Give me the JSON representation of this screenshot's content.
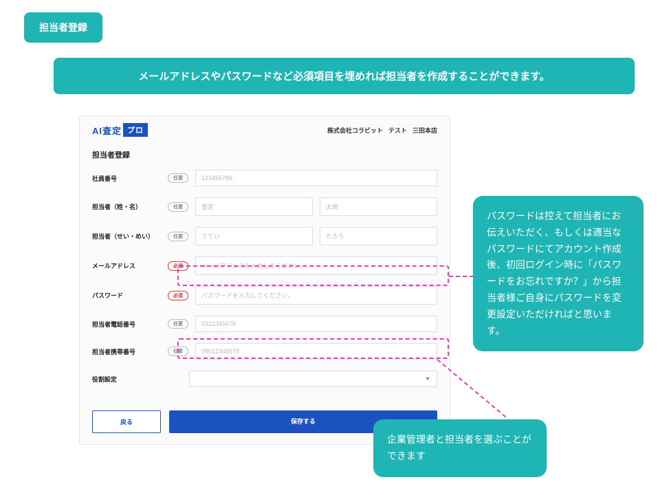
{
  "section_badge": "担当者登録",
  "instruction_banner": "メールアドレスやパスワードなど必須項目を埋めれば担当者を作成することができます。",
  "logo": {
    "text": "AI査定",
    "box": "プロ"
  },
  "company": {
    "name": "株式会社コラビット",
    "test": "テスト",
    "branch": "三田本店"
  },
  "form_title": "担当者登録",
  "tags": {
    "optional": "任意",
    "required": "必須"
  },
  "rows": {
    "emp_no": {
      "label": "社員番号",
      "placeholder": "123456789"
    },
    "name": {
      "label": "担当者（姓・名）",
      "ph1": "査定",
      "ph2": "太郎"
    },
    "kana": {
      "label": "担当者（せい・めい）",
      "ph1": "さてい",
      "ph2": "たろう"
    },
    "email": {
      "label": "メールアドレス",
      "placeholder": "メールアドレスを入力してください。"
    },
    "password": {
      "label": "パスワード",
      "placeholder": "パスワードを入力してください。"
    },
    "tel": {
      "label": "担当者電話番号",
      "placeholder": "0312345678"
    },
    "mobile": {
      "label": "担当者携帯番号",
      "placeholder": "09012345678"
    },
    "role": {
      "label": "役割設定"
    }
  },
  "buttons": {
    "back": "戻る",
    "save": "保存する"
  },
  "callouts": {
    "password": "パスワードは控えて担当者にお伝えいただく、もしくは適当なパスワードにてアカウント作成後、初回ログイン時に「パスワードをお忘れですか？」から担当者様ご自身にパスワードを変更設定いただければと思います。",
    "role": "企業管理者と担当者を選ぶことができます"
  }
}
